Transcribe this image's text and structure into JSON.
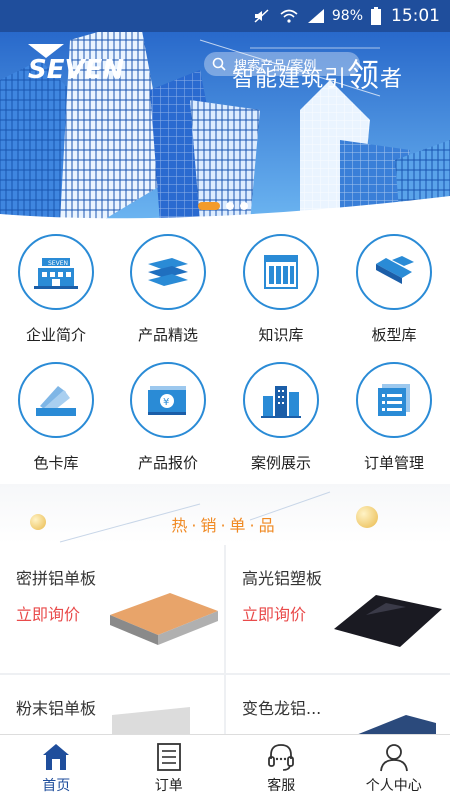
{
  "status_bar": {
    "battery": "98%",
    "time": "15:01",
    "icons": [
      "mute-icon",
      "wifi-icon",
      "signal-icon",
      "battery-icon"
    ]
  },
  "banner": {
    "logo_text": "SEVEN",
    "search_placeholder": "搜索产品/案例",
    "slogan_prefix": "智能建筑引",
    "slogan_big": "领",
    "slogan_suffix": "者",
    "active_slide": 1,
    "slide_count": 3
  },
  "grid": [
    {
      "label": "企业简介",
      "icon": "company-building-icon"
    },
    {
      "label": "产品精选",
      "icon": "panels-stack-icon"
    },
    {
      "label": "知识库",
      "icon": "bookshelf-icon"
    },
    {
      "label": "板型库",
      "icon": "boards-icon"
    },
    {
      "label": "色卡库",
      "icon": "color-card-icon"
    },
    {
      "label": "产品报价",
      "icon": "money-icon"
    },
    {
      "label": "案例展示",
      "icon": "buildings-icon"
    },
    {
      "label": "订单管理",
      "icon": "order-list-icon"
    }
  ],
  "hot": {
    "title": "热·销·单·品"
  },
  "products": [
    {
      "name": "密拼铝单板",
      "action": "立即询价",
      "image": "copper-panel"
    },
    {
      "name": "高光铝塑板",
      "action": "立即询价",
      "image": "black-glossy-panel"
    },
    {
      "name": "粉末铝单板",
      "action": "",
      "image": "powder-panel"
    },
    {
      "name": "变色龙铝...",
      "action": "",
      "image": "chameleon-panel"
    }
  ],
  "tabbar": [
    {
      "label": "首页",
      "icon": "home-icon",
      "active": true
    },
    {
      "label": "订单",
      "icon": "order-icon",
      "active": false
    },
    {
      "label": "客服",
      "icon": "headset-icon",
      "active": false
    },
    {
      "label": "个人中心",
      "icon": "user-icon",
      "active": false
    }
  ],
  "colors": {
    "primary": "#1f4e9c",
    "accent": "#2a8bd6",
    "hot_title": "#f08a24",
    "inquire": "#e94b4b"
  }
}
